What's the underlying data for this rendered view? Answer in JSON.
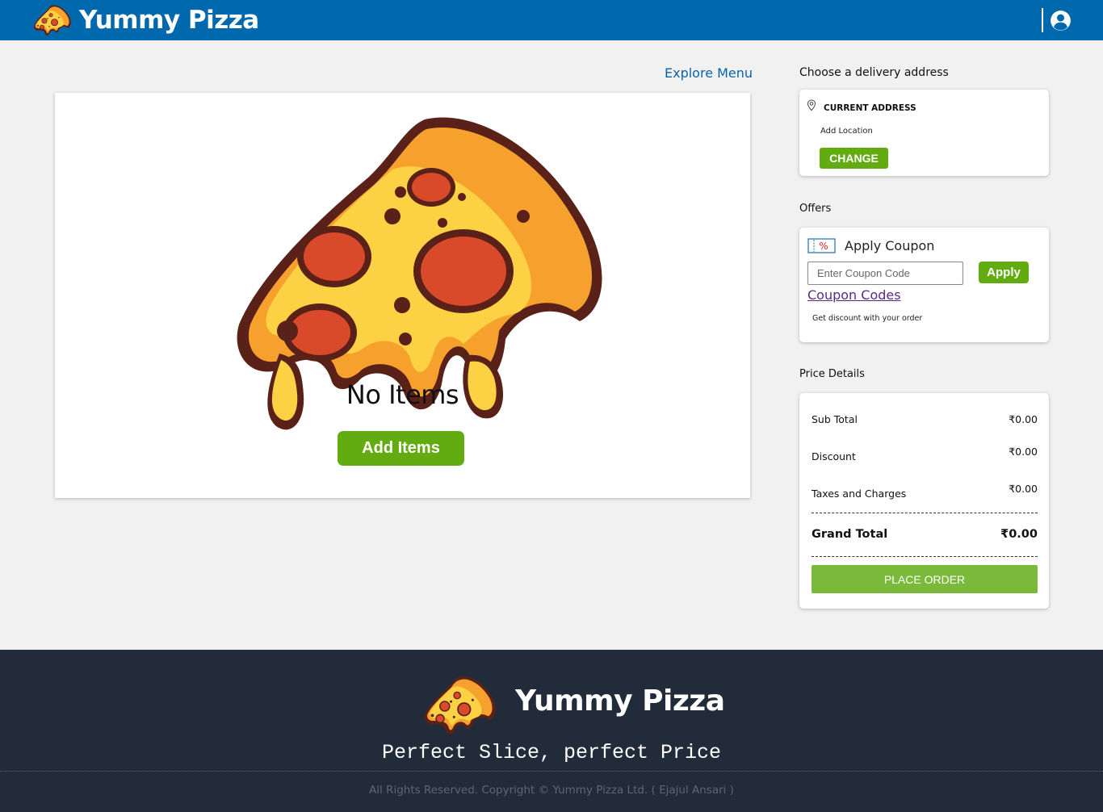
{
  "header": {
    "brand": "Yummy Pizza",
    "brand_color": "#0068ad",
    "user_icon": "user-circle-icon"
  },
  "main": {
    "explore_link": "Explore Menu",
    "empty_message": "No Items",
    "add_items_label": "Add Items"
  },
  "delivery": {
    "title": "Choose a delivery address",
    "address_label": "CURRENT ADDRESS",
    "address_sub": "Add Location",
    "change_label": "CHANGE"
  },
  "offers": {
    "title": "Offers",
    "coupon_title": "Apply Coupon",
    "coupon_placeholder": "Enter Coupon Code",
    "apply_label": "Apply",
    "coupon_codes_link": "Coupon Codes",
    "note": "Get discount with your order"
  },
  "price": {
    "title": "Price Details",
    "rows": [
      {
        "label": "Sub Total",
        "value": "₹0.00"
      },
      {
        "label": "Discount",
        "value": "₹0.00"
      },
      {
        "label": "Taxes and Charges",
        "value": "₹0.00"
      }
    ],
    "grand_label": "Grand Total",
    "grand_value": "₹0.00",
    "place_order_label": "PLACE ORDER"
  },
  "footer": {
    "brand": "Yummy Pizza",
    "tagline": "Perfect Slice, perfect Price",
    "copyright": "All Rights Reserved. Copyright © Yummy Pizza Ltd. ( Ejajul Ansari )"
  },
  "colors": {
    "accent_green": "#62ac12",
    "place_order_green": "#7ab93a",
    "footer_bg": "#222b39"
  }
}
